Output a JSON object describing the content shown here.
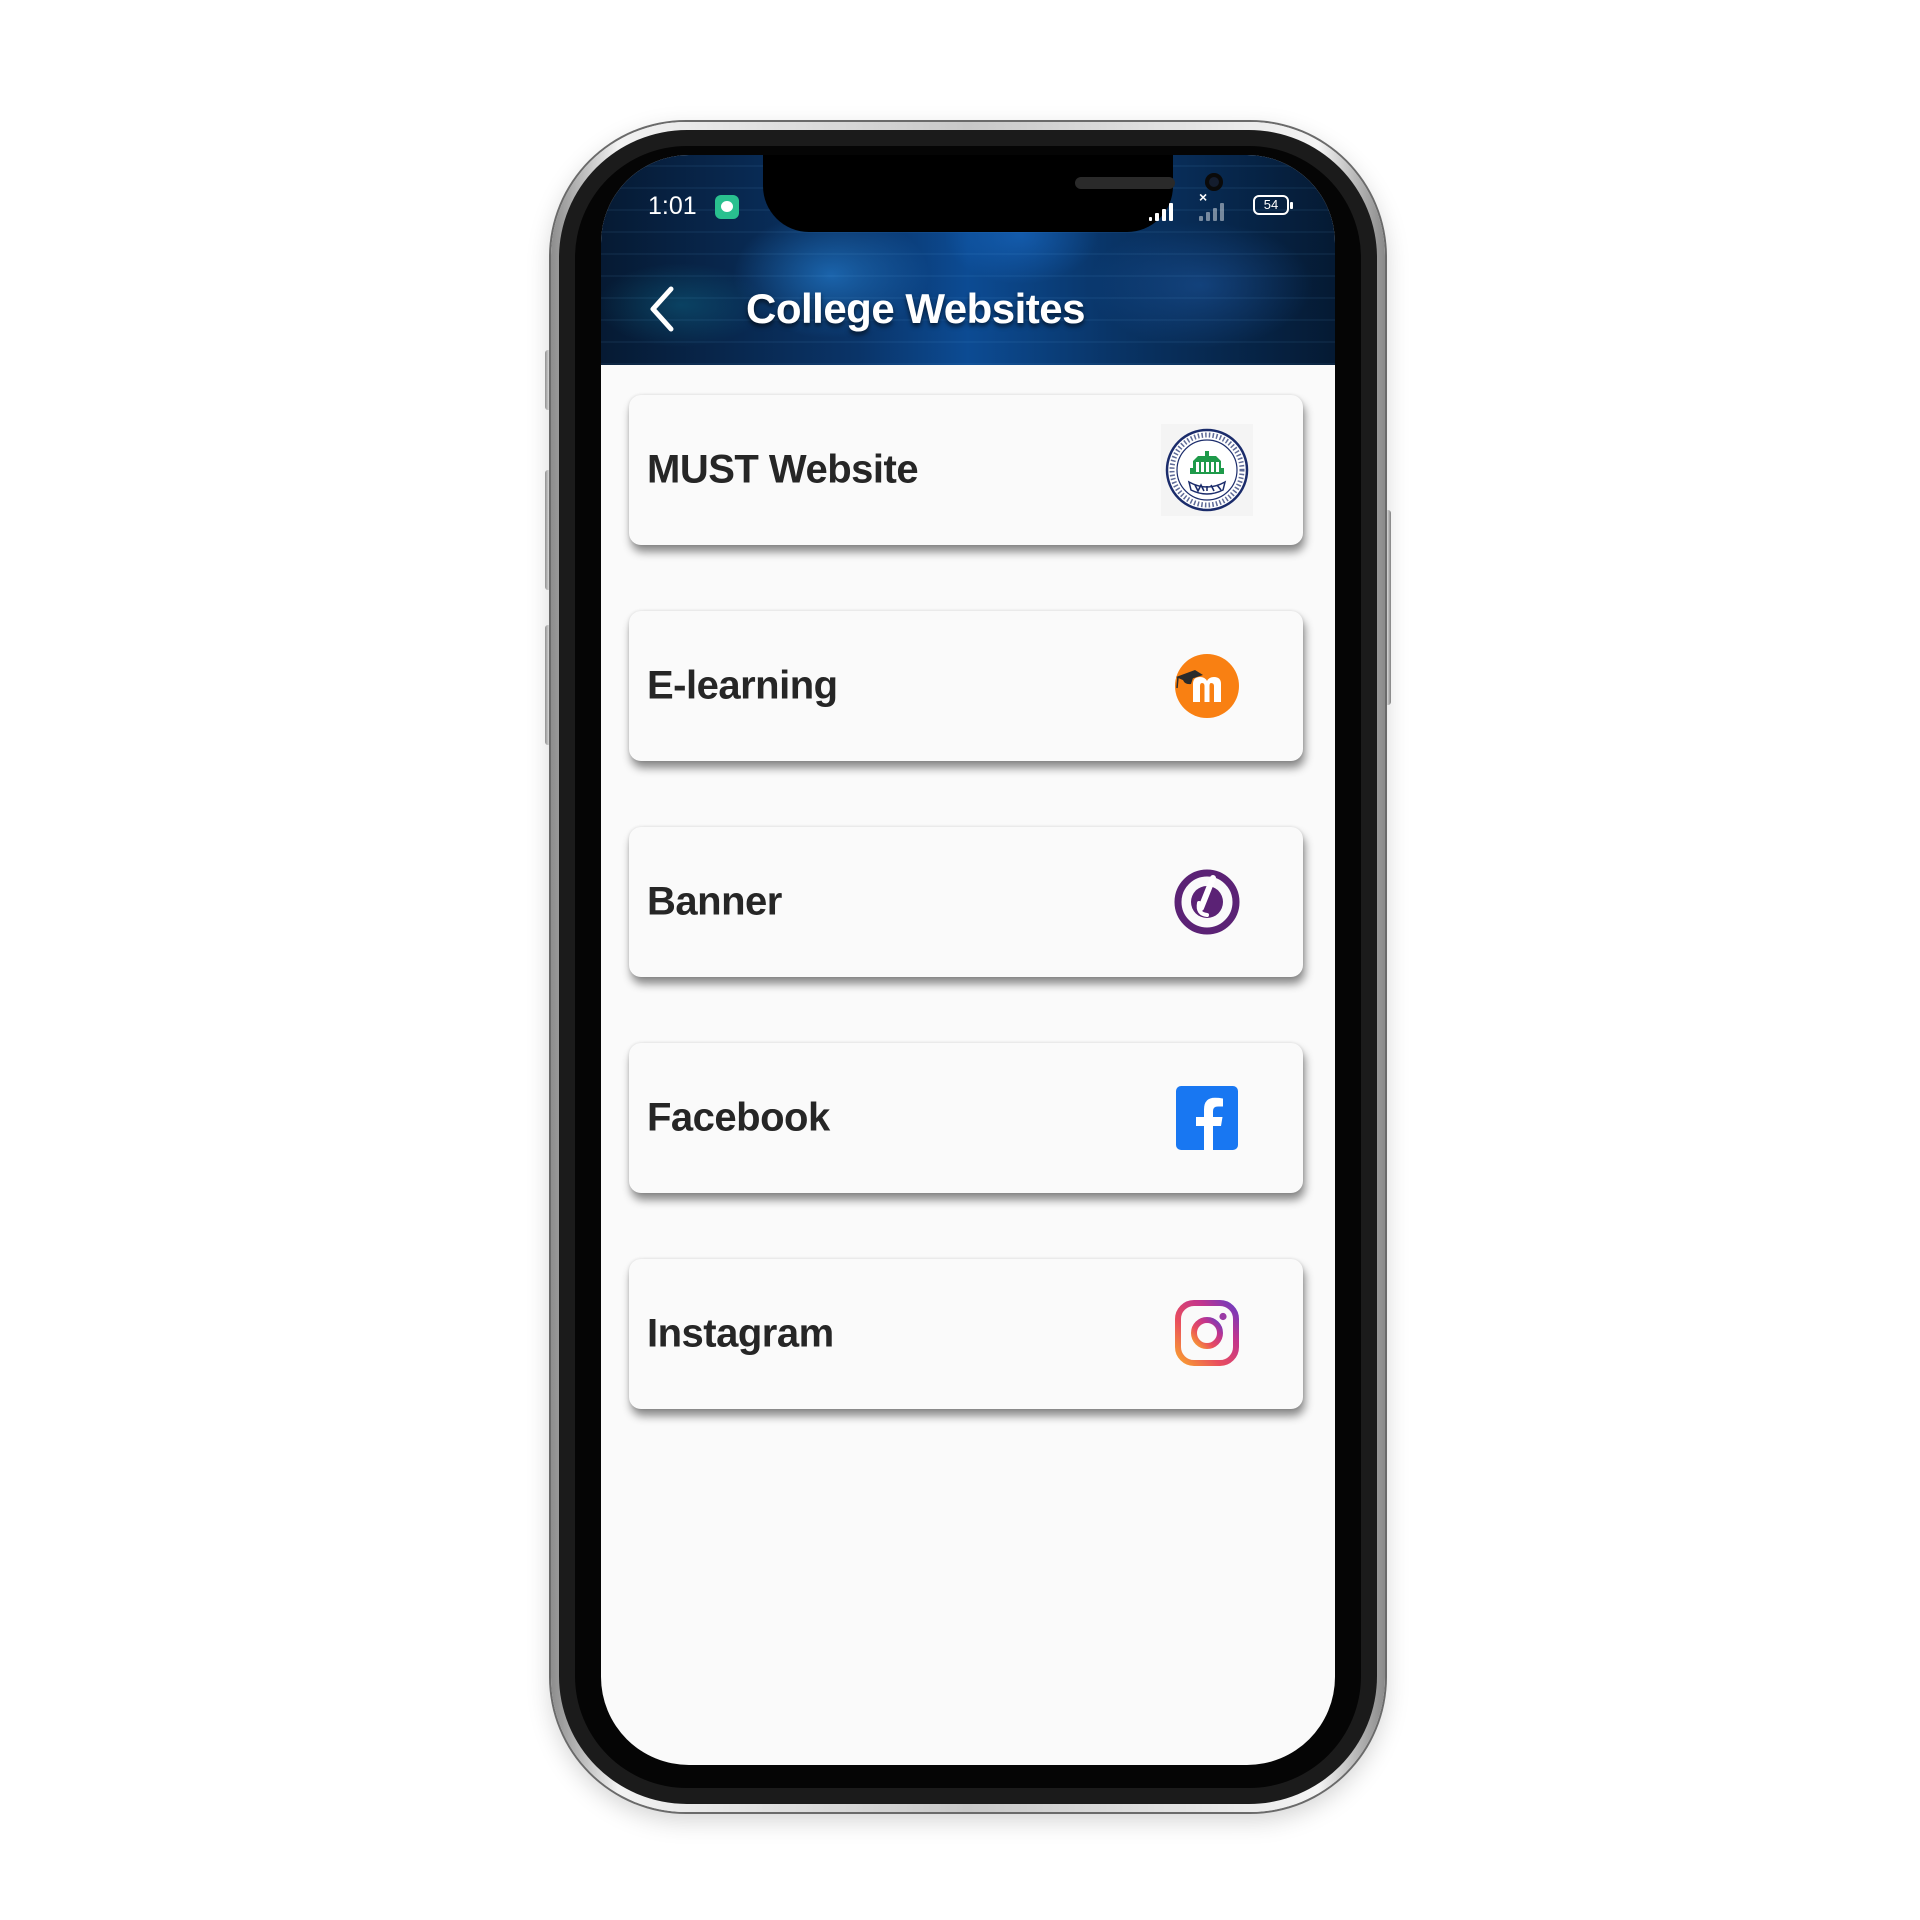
{
  "status_bar": {
    "time": "1:01",
    "battery": "54"
  },
  "header": {
    "title": "College Websites",
    "back_icon": "chevron-left-icon"
  },
  "links": [
    {
      "label": "MUST Website",
      "icon": "must-logo-icon"
    },
    {
      "label": "E-learning",
      "icon": "moodle-icon"
    },
    {
      "label": "Banner",
      "icon": "ellucian-banner-icon"
    },
    {
      "label": "Facebook",
      "icon": "facebook-icon"
    },
    {
      "label": "Instagram",
      "icon": "instagram-icon"
    }
  ],
  "colors": {
    "header_blue": "#0c4b93",
    "moodle_orange": "#f98012",
    "banner_purple": "#5b2275",
    "facebook_blue": "#1877f2",
    "must_green": "#1e9a4a",
    "must_navy": "#1b2c6b"
  }
}
